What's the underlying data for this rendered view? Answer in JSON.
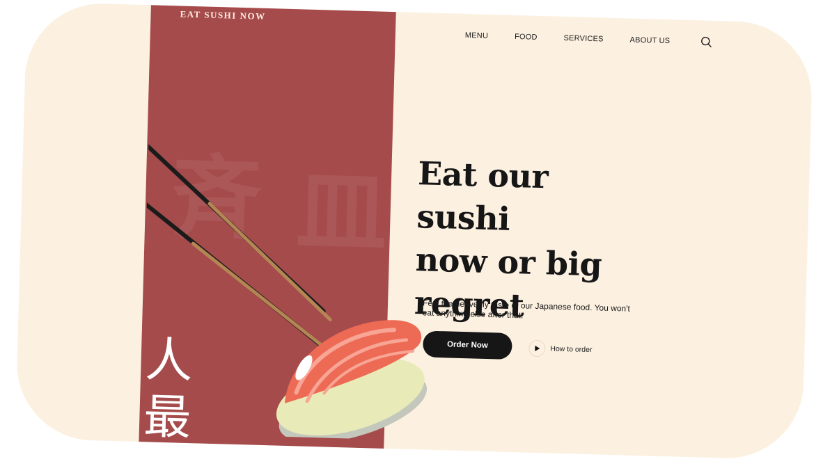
{
  "brand": {
    "name": "EAT SUSHI NOW"
  },
  "nav": {
    "items": [
      {
        "label": "MENU"
      },
      {
        "label": "FOOD"
      },
      {
        "label": "SERVICES"
      },
      {
        "label": "ABOUT US"
      }
    ],
    "search_icon": "search-icon"
  },
  "hero": {
    "headline_lines": [
      "Eat our sushi",
      "now or big",
      "regret"
    ],
    "tagline": "Feel the heavenly taste of our Japanese food. You won't eat anything else after that.",
    "primary_button": "Order Now",
    "secondary_link": "How to order",
    "vertical_text": "人\n最"
  },
  "colors": {
    "background": "#fcf0e0",
    "panel": "#a54b4b",
    "text": "#161616",
    "button": "#161616",
    "salmon": "#f0705a",
    "rice": "#eef0c8"
  },
  "icons": {
    "play": "play-icon",
    "search": "search-icon",
    "chopsticks": "chopsticks-icon",
    "sushi": "sushi-illustration"
  }
}
